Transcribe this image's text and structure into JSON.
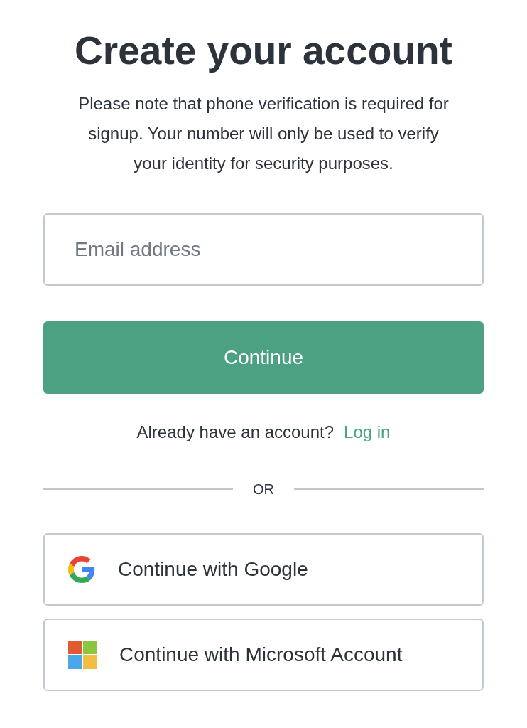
{
  "title": "Create your account",
  "notice": "Please note that phone verification is required for signup. Your number will only be used to verify your identity for security purposes.",
  "email_field": {
    "placeholder": "Email address"
  },
  "continue_button": "Continue",
  "login_prompt": {
    "text": "Already have an account?",
    "link": "Log in"
  },
  "divider": "OR",
  "providers": [
    {
      "kind": "google",
      "label": "Continue with Google"
    },
    {
      "kind": "microsoft",
      "label": "Continue with Microsoft Account"
    }
  ]
}
